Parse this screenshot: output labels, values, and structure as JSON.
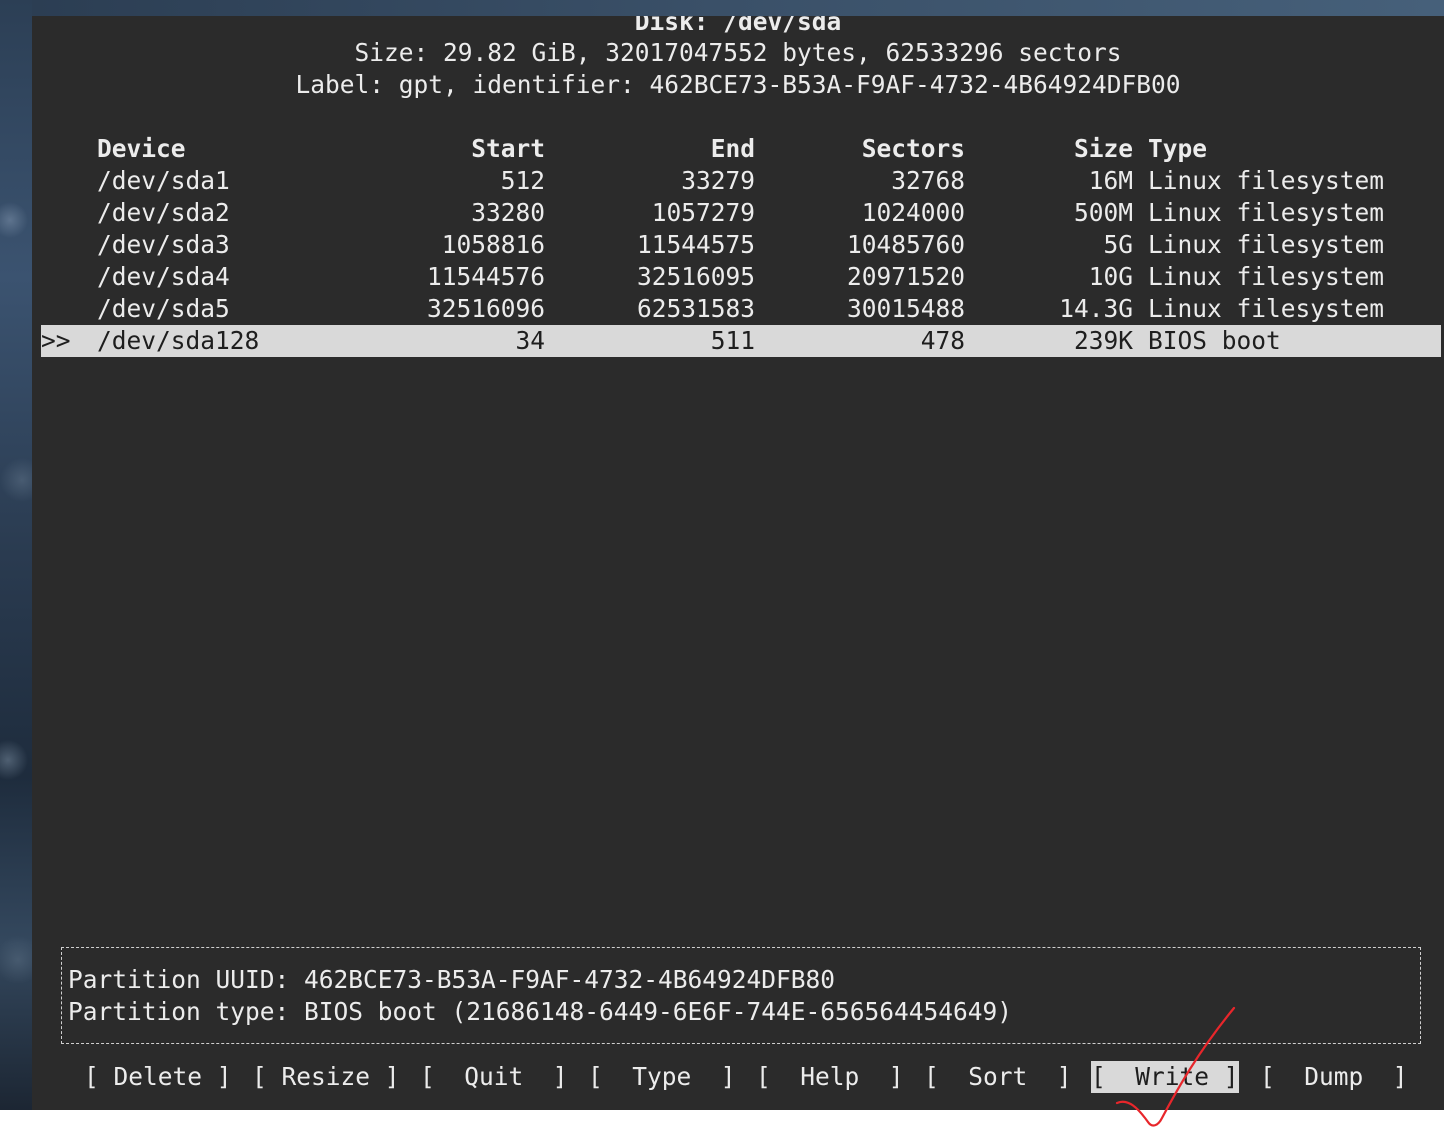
{
  "header": {
    "disk_line": "Disk: /dev/sda",
    "size_line": "Size: 29.82 GiB, 32017047552 bytes, 62533296 sectors",
    "label_line": "Label: gpt, identifier: 462BCE73-B53A-F9AF-4732-4B64924DFB00"
  },
  "table": {
    "columns": {
      "device": "Device",
      "start": "Start",
      "end": "End",
      "sectors": "Sectors",
      "size": "Size",
      "type": "Type"
    },
    "selector": ">>",
    "rows": [
      {
        "device": "/dev/sda1",
        "start": "512",
        "end": "33279",
        "sectors": "32768",
        "size": "16M",
        "type": "Linux filesystem"
      },
      {
        "device": "/dev/sda2",
        "start": "33280",
        "end": "1057279",
        "sectors": "1024000",
        "size": "500M",
        "type": "Linux filesystem"
      },
      {
        "device": "/dev/sda3",
        "start": "1058816",
        "end": "11544575",
        "sectors": "10485760",
        "size": "5G",
        "type": "Linux filesystem"
      },
      {
        "device": "/dev/sda4",
        "start": "11544576",
        "end": "32516095",
        "sectors": "20971520",
        "size": "10G",
        "type": "Linux filesystem"
      },
      {
        "device": "/dev/sda5",
        "start": "32516096",
        "end": "62531583",
        "sectors": "30015488",
        "size": "14.3G",
        "type": "Linux filesystem"
      },
      {
        "device": "/dev/sda128",
        "start": "34",
        "end": "511",
        "sectors": "478",
        "size": "239K",
        "type": "BIOS boot"
      }
    ]
  },
  "info": {
    "uuid_line": "Partition UUID: 462BCE73-B53A-F9AF-4732-4B64924DFB80",
    "type_line": "Partition type: BIOS boot (21686148-6449-6E6F-744E-656564454649)"
  },
  "menu": {
    "delete": "[ Delete ]",
    "resize": "[ Resize ]",
    "quit": "[  Quit  ]",
    "type": "[  Type  ]",
    "help": "[  Help  ]",
    "sort": "[  Sort  ]",
    "write": "[  Write ]",
    "dump": "[  Dump  ]"
  },
  "colors": {
    "terminal_bg": "#2b2b2b",
    "text": "#ececec",
    "highlight_bg": "#d9d9d9",
    "annotation": "#e8262b"
  }
}
